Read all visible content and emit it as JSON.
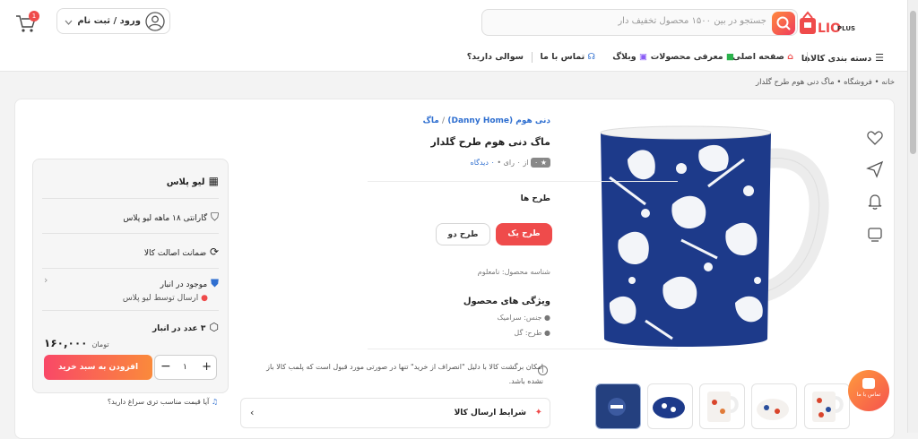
{
  "header": {
    "logo_text": "LIO",
    "logo_sub": "PLUS",
    "search_placeholder": "جستجو در بین ۱۵۰۰ محصول تخفیف دار",
    "login_label": "ورود / ثبت نام",
    "cart_badge": "1"
  },
  "nav": {
    "categories": "دسته بندی کالاها",
    "home": "صفحه اصلی",
    "products": "معرفی محصولات",
    "blog": "وبلاگ",
    "contact": "تماس با ما",
    "faq": "سوالی دارید؟"
  },
  "breadcrumb": "خانه • فروشگاه • ماگ دنی هوم طرح گلدار",
  "product": {
    "brand": "دنی هوم (Danny Home)",
    "category": "ماگ",
    "title": "ماگ دنی هوم طرح گلدار",
    "rating": "۰",
    "rating_count": "از ۰ رای",
    "reviews": "۰ دیدگاه",
    "designs_title": "طرح ها",
    "design_1": "طرح یک",
    "design_2": "طرح دو",
    "sku": "شناسه محصول: نامعلوم",
    "features_title": "ویژگی های محصول",
    "feature_1": "جنس: سرامیک",
    "feature_2": "طرح: گل",
    "return_note": "امکان برگشت کالا با دلیل \"انصراف از خرید\" تنها در صورتی مورد قبول است که پلمب کالا باز نشده باشد.",
    "shipping_title": "شرایط ارسال کالا"
  },
  "seller": {
    "name": "لیو پلاس",
    "warranty": "گارانتی ۱۸ ماهه لیو پلاس",
    "authentic": "ضمانت اصالت کالا",
    "stock_status": "موجود در انبار",
    "shipping_by": "ارسال توسط لیو پلاس",
    "stock_count": "۳ عدد در انبار",
    "price": "۱۶۰,۰۰۰",
    "currency": "تومان",
    "add_to_cart": "افزودن به سبد خرید",
    "qty": "۱",
    "better_price": "آیا قیمت مناسب تری سراغ دارید؟"
  },
  "chat": {
    "label": "تماس با ما"
  },
  "colors": {
    "accent": "#ef4b4b",
    "brand_blue": "#1d3a8a",
    "link": "#2f6fd0"
  }
}
